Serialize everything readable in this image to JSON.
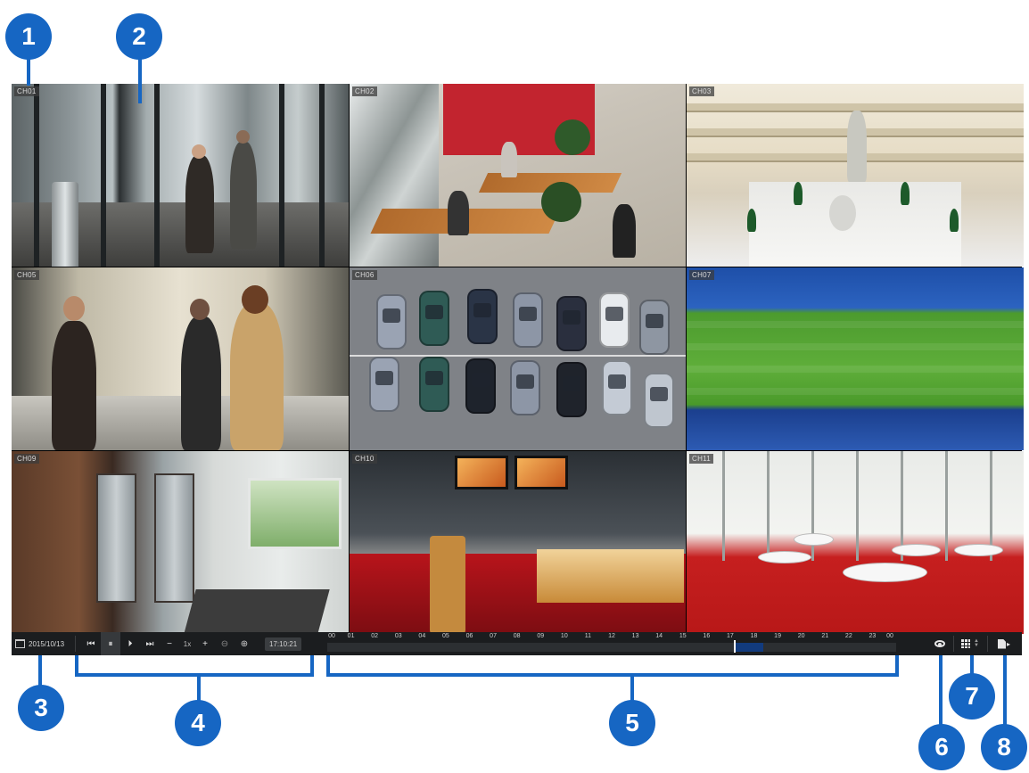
{
  "channels": [
    {
      "label": "CH01"
    },
    {
      "label": "CH02"
    },
    {
      "label": "CH03"
    },
    {
      "label": "CH05"
    },
    {
      "label": "CH06"
    },
    {
      "label": "CH07"
    },
    {
      "label": "CH09"
    },
    {
      "label": "CH10"
    },
    {
      "label": "CH11"
    }
  ],
  "controls": {
    "date": "2015/10/13",
    "speed": "1x",
    "time": "17:10:21",
    "icons": [
      "calendar-icon",
      "step-back-icon",
      "pause-icon",
      "play-slow-icon",
      "step-forward-icon",
      "minus-icon",
      "plus-icon",
      "zoom-out-icon",
      "zoom-in-icon"
    ]
  },
  "timeline": {
    "hours": [
      "00",
      "01",
      "02",
      "03",
      "04",
      "05",
      "06",
      "07",
      "08",
      "09",
      "10",
      "11",
      "12",
      "13",
      "14",
      "15",
      "16",
      "17",
      "18",
      "19",
      "20",
      "21",
      "22",
      "23",
      "00"
    ],
    "recording_start_hour": 17.2,
    "recording_end_hour": 18.4,
    "cursor_hour": 17.17
  },
  "right_controls": {
    "icons": [
      "eye-icon",
      "grid-layout-icon",
      "export-icon"
    ]
  },
  "callouts": [
    "1",
    "2",
    "3",
    "4",
    "5",
    "6",
    "7",
    "8"
  ],
  "colors": {
    "callout": "#1666c3",
    "bar": "#1b1d1f",
    "recording": "#123b7e"
  }
}
